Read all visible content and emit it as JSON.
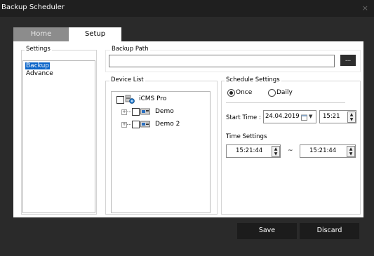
{
  "window": {
    "title": "Backup Scheduler",
    "close_glyph": "×"
  },
  "tabs": [
    {
      "label": "Home"
    },
    {
      "label": "Setup"
    }
  ],
  "settings": {
    "legend": "Settings",
    "items": [
      {
        "label": "Backup",
        "selected": true
      },
      {
        "label": "Advance",
        "selected": false
      }
    ]
  },
  "backup_path": {
    "legend": "Backup Path",
    "value": "",
    "browse_label": "..."
  },
  "device_list": {
    "legend": "Device List",
    "root": {
      "label": "iCMS Pro",
      "icon": "camera-server-icon"
    },
    "children": [
      {
        "label": "Demo",
        "icon": "dvr-device-icon"
      },
      {
        "label": "Demo 2",
        "icon": "dvr-device-icon"
      }
    ]
  },
  "schedule": {
    "legend": "Schedule Settings",
    "once_label": "Once",
    "daily_label": "Daily",
    "selected": "Once",
    "start_time_label": "Start Time :",
    "start_date": "24.04.2019",
    "start_time": "15:21",
    "time_settings_label": "Time Settings",
    "time_from": "15:21:44",
    "time_sep": "~",
    "time_to": "15:21:44"
  },
  "footer": {
    "save_label": "Save",
    "discard_label": "Discard"
  }
}
